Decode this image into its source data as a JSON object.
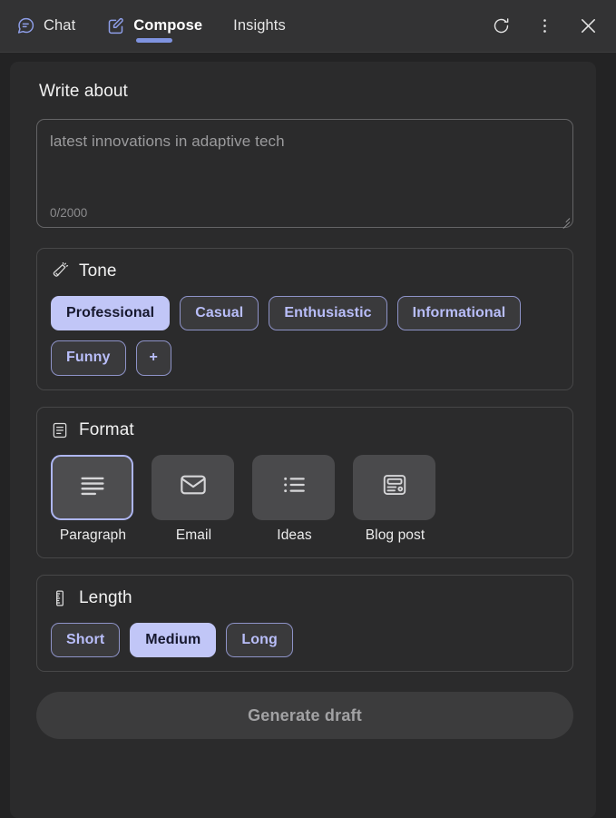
{
  "header": {
    "tabs": [
      {
        "label": "Chat",
        "icon": "chat-bubble-icon",
        "active": false
      },
      {
        "label": "Compose",
        "icon": "compose-pencil-icon",
        "active": true
      },
      {
        "label": "Insights",
        "icon": "",
        "active": false
      }
    ],
    "actions": [
      {
        "name": "refresh-icon",
        "title": "Refresh"
      },
      {
        "name": "more-options-icon",
        "title": "More options"
      },
      {
        "name": "close-icon",
        "title": "Close"
      }
    ]
  },
  "compose": {
    "write_about_label": "Write about",
    "prompt": {
      "placeholder": "latest innovations in adaptive tech",
      "value": "",
      "counter": "0/2000",
      "max_length": 2000
    },
    "tone": {
      "title": "Tone",
      "icon": "megaphone-icon",
      "options": [
        {
          "label": "Professional",
          "selected": true
        },
        {
          "label": "Casual",
          "selected": false
        },
        {
          "label": "Enthusiastic",
          "selected": false
        },
        {
          "label": "Informational",
          "selected": false
        },
        {
          "label": "Funny",
          "selected": false
        }
      ],
      "add_label": "+"
    },
    "format": {
      "title": "Format",
      "icon": "document-lines-icon",
      "options": [
        {
          "label": "Paragraph",
          "icon": "paragraph-lines-icon",
          "selected": true
        },
        {
          "label": "Email",
          "icon": "envelope-icon",
          "selected": false
        },
        {
          "label": "Ideas",
          "icon": "bulleted-list-icon",
          "selected": false
        },
        {
          "label": "Blog post",
          "icon": "article-icon",
          "selected": false
        }
      ]
    },
    "length": {
      "title": "Length",
      "icon": "ruler-icon",
      "options": [
        {
          "label": "Short",
          "selected": false
        },
        {
          "label": "Medium",
          "selected": true
        },
        {
          "label": "Long",
          "selected": false
        }
      ]
    },
    "generate_label": "Generate draft"
  },
  "colors": {
    "accent": "#7f93e0",
    "chip_selected_bg": "#c1c6f7",
    "chip_text": "#b9befa",
    "page_bg": "#232324",
    "card_bg": "#2b2b2c",
    "header_bg": "#333334"
  }
}
